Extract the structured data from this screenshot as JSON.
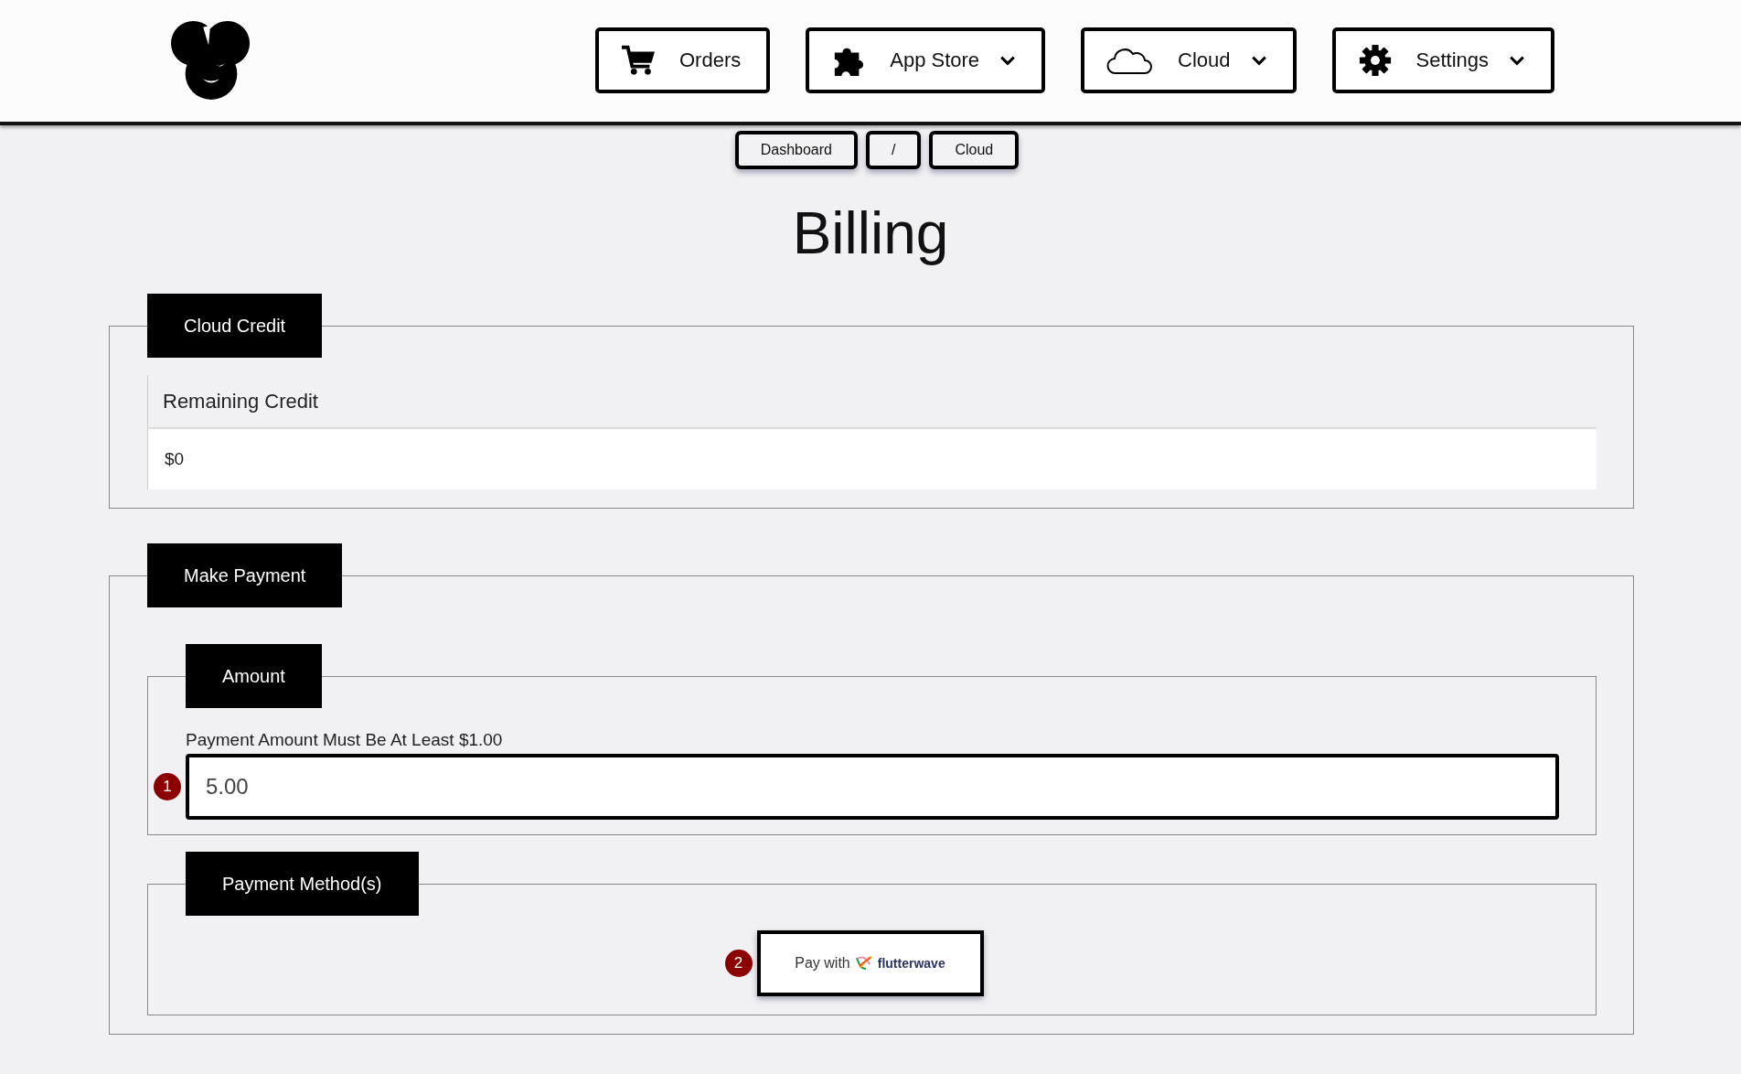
{
  "header": {
    "nav": [
      {
        "label": "Orders",
        "kind": "cart",
        "dropdown": false
      },
      {
        "label": "App Store",
        "kind": "puzzle",
        "dropdown": true
      },
      {
        "label": "Cloud",
        "kind": "cloud",
        "dropdown": true
      },
      {
        "label": "Settings",
        "kind": "gear",
        "dropdown": true
      }
    ]
  },
  "breadcrumbs": [
    {
      "label": "Dashboard"
    },
    {
      "label": "/"
    },
    {
      "label": "Cloud"
    }
  ],
  "title": "Billing",
  "cloud_credit": {
    "legend": "Cloud Credit",
    "label": "Remaining Credit",
    "value": "$0"
  },
  "make_payment": {
    "legend": "Make Payment",
    "amount": {
      "legend": "Amount",
      "hint": "Payment Amount Must Be At Least $1.00",
      "value": "5.00",
      "step": "1"
    },
    "methods": {
      "legend": "Payment Method(s)",
      "step": "2",
      "button": {
        "prefix": "Pay with",
        "brand": "flutterwave"
      }
    }
  }
}
